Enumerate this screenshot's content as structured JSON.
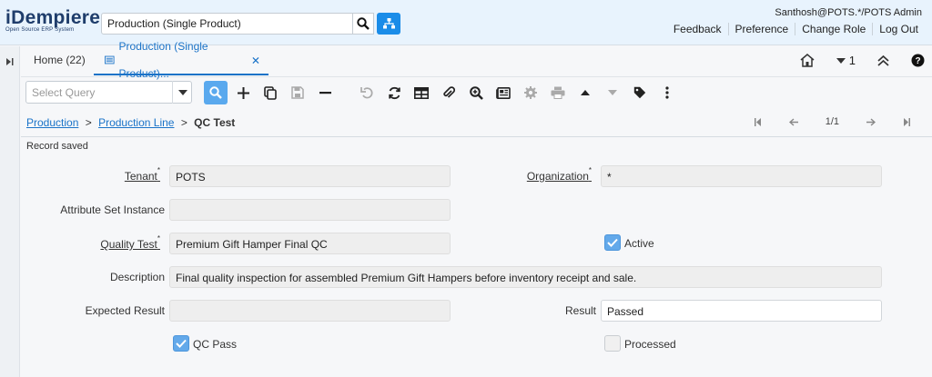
{
  "header": {
    "logo": {
      "name": "iDempiere",
      "tagline": "Open Source ERP System"
    },
    "search_value": "Production (Single Product)",
    "user": "Santhosh@POTS.*/POTS Admin",
    "links": [
      "Feedback",
      "Preference",
      "Change Role",
      "Log Out"
    ]
  },
  "tabs": {
    "home": "Home (22)",
    "active": "Production (Single Product)...",
    "count": "1"
  },
  "toolbar": {
    "query_placeholder": "Select Query"
  },
  "breadcrumb": {
    "items": [
      "Production",
      "Production Line"
    ],
    "current": "QC Test",
    "sep": ">"
  },
  "navigation": {
    "position": "1/1"
  },
  "status": "Record saved",
  "form": {
    "tenant": {
      "label": "Tenant",
      "value": "POTS"
    },
    "organization": {
      "label": "Organization",
      "value": "*"
    },
    "attribute_set_instance": {
      "label": "Attribute Set Instance",
      "value": ""
    },
    "quality_test": {
      "label": "Quality Test",
      "value": "Premium Gift Hamper Final QC"
    },
    "active": {
      "label": "Active",
      "checked": true
    },
    "description": {
      "label": "Description",
      "value": "Final quality inspection for assembled Premium Gift Hampers before inventory receipt and sale."
    },
    "expected_result": {
      "label": "Expected Result",
      "value": ""
    },
    "result": {
      "label": "Result",
      "value": "Passed"
    },
    "qc_pass": {
      "label": "QC Pass",
      "checked": true
    },
    "processed": {
      "label": "Processed",
      "checked": false
    }
  },
  "colors": {
    "accent": "#1a8ce8",
    "link": "#1a73c8",
    "header_bg": "#e8f3fd",
    "check": "#63a9ea"
  }
}
